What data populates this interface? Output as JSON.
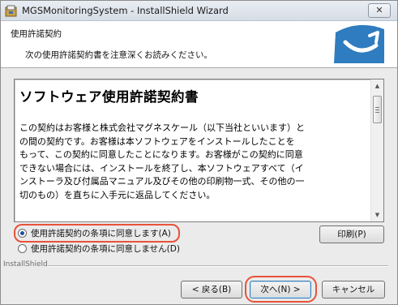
{
  "window": {
    "title": "MGSMonitoringSystem - InstallShield Wizard",
    "close_glyph": "✕"
  },
  "header": {
    "title": "使用許諾契約",
    "subtitle": "次の使用許諾契約書を注意深くお読みください。",
    "logo_icon": "installshield-swoosh-icon"
  },
  "license": {
    "title": "ソフトウェア使用許諾契約書",
    "lines": [
      "この契約はお客様と株式会社マグネスケール（以下当社といいます）と",
      "の間の契約です。お客様は本ソフトウェアをインストールしたことを",
      "もって、この契約に同意したことになります。お客様がこの契約に同意",
      "できない場合には、インストールを終了し、本ソフトウェアすべて（イ",
      "ンストーラ及び付属品マニュアル及びその他の印刷物一式、その他の一",
      "切のもの）を直ちに入手元に返品してください。"
    ]
  },
  "options": {
    "accept_label": "使用許諾契約の条項に同意します(A)",
    "decline_label": "使用許諾契約の条項に同意しません(D)",
    "selected": "accept"
  },
  "buttons": {
    "print": "印刷(P)",
    "back": "< 戻る(B)",
    "next": "次へ(N) >",
    "cancel": "キャンセル"
  },
  "footer": {
    "brand": "InstallShield"
  },
  "colors": {
    "highlight": "#e8523a",
    "logo_blue": "#2f7cc0"
  }
}
